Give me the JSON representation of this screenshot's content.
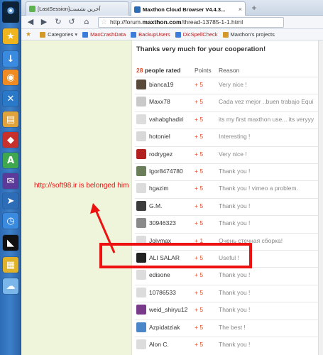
{
  "tabs": [
    {
      "label": "[LastSession]آخرین نشست",
      "active": false
    },
    {
      "label": "Maxthon Cloud Browser V4.4.3...",
      "active": true
    }
  ],
  "toolbar": {
    "url_prefix": "http://forum.",
    "url_domain": "maxthon.com",
    "url_path": "/thread-13785-1-1.html"
  },
  "bookmarks": [
    {
      "label": "Categories",
      "red": false,
      "color": "#d39a2b"
    },
    {
      "label": "MaxCrashData",
      "red": true,
      "color": "#3b7dd8"
    },
    {
      "label": "BackupUsers",
      "red": true,
      "color": "#3b7dd8"
    },
    {
      "label": "DicSpellCheck",
      "red": true,
      "color": "#3b7dd8"
    },
    {
      "label": "Maxthon's projects",
      "red": false,
      "color": "#d39a2b"
    }
  ],
  "page": {
    "thanks_text": "Thanks very much for your cooperation!",
    "rated_count": "28",
    "people_rated_label": "people rated",
    "points_label": "Points",
    "reason_label": "Reason"
  },
  "rows": [
    {
      "name": "bianca19",
      "points": "+ 5",
      "reason": "Very nice !",
      "avatar": "#5a4a3a"
    },
    {
      "name": "Maxx78",
      "points": "+ 5",
      "reason": "Cada vez mejor ..buen trabajo Equi",
      "avatar": "#c9c9c9"
    },
    {
      "name": "vahabghadiri",
      "points": "+ 5",
      "reason": "its my first maxthon use... its veryyy",
      "avatar": "#dcdcdc"
    },
    {
      "name": "hotoniel",
      "points": "+ 5",
      "reason": "Interesting !",
      "avatar": "#d8d8d8"
    },
    {
      "name": "rodrygez",
      "points": "+ 5",
      "reason": "Very nice !",
      "avatar": "#b32020"
    },
    {
      "name": "Igor8474780",
      "points": "+ 5",
      "reason": "Thank you !",
      "avatar": "#6a7e5a"
    },
    {
      "name": "hgazim",
      "points": "+ 5",
      "reason": "Thank you ! vimeo a problem.",
      "avatar": "#dcdcdc"
    },
    {
      "name": "G.M.",
      "points": "+ 5",
      "reason": "Thank you !",
      "avatar": "#3c3c3c"
    },
    {
      "name": "30946323",
      "points": "+ 5",
      "reason": "Thank you !",
      "avatar": "#8a8a8a"
    },
    {
      "name": "Jolymax",
      "points": "+ 1",
      "reason": "Очень стечная сборка!",
      "avatar": "#dcdcdc"
    },
    {
      "name": "ALI SALAR",
      "points": "+ 5",
      "reason": "Useful !",
      "avatar": "#222222"
    },
    {
      "name": "edisone",
      "points": "+ 5",
      "reason": "Thank you !",
      "avatar": "#dcdcdc"
    },
    {
      "name": "10786533",
      "points": "+ 5",
      "reason": "Thank you !",
      "avatar": "#dcdcdc"
    },
    {
      "name": "weid_shiryu12",
      "points": "+ 5",
      "reason": "Thank you !",
      "avatar": "#7a3a8a"
    },
    {
      "name": "Azpidatziak",
      "points": "+ 5",
      "reason": "The best !",
      "avatar": "#4a86c8"
    },
    {
      "name": "Alon C.",
      "points": "+ 5",
      "reason": "Thank you !",
      "avatar": "#dcdcdc"
    }
  ],
  "annotation": {
    "text": "http://soft98.ir is belonged him",
    "color": "#ee1111"
  },
  "sidebar_icons": [
    {
      "icon": "favorites-star-icon",
      "color": "#f0b41e",
      "glyph": "★"
    },
    {
      "icon": "download-icon",
      "color": "#3a8be0",
      "glyph": "↓"
    },
    {
      "icon": "rss-feed-icon",
      "color": "#f08a22",
      "glyph": "◉"
    },
    {
      "icon": "tools-icon",
      "color": "#2a78c8",
      "glyph": "✕"
    },
    {
      "icon": "notes-icon",
      "color": "#e0a23a",
      "glyph": "▤"
    },
    {
      "icon": "games-icon",
      "color": "#c8302c",
      "glyph": "◆"
    },
    {
      "icon": "translate-icon",
      "color": "#3fa84e",
      "glyph": "A"
    },
    {
      "icon": "yahoo-mail-icon",
      "color": "#5b3a99",
      "glyph": "✉"
    },
    {
      "icon": "cursor-icon",
      "color": "#2d6cb6",
      "glyph": "➤"
    },
    {
      "icon": "clock-icon",
      "color": "#3a8be0",
      "glyph": "◷"
    },
    {
      "icon": "black-cat-icon",
      "color": "#111111",
      "glyph": "◣"
    },
    {
      "icon": "keyboard-icon",
      "color": "#e0b12a",
      "glyph": "▦"
    },
    {
      "icon": "cloud-icon",
      "color": "#7ab6ea",
      "glyph": "☁"
    }
  ]
}
